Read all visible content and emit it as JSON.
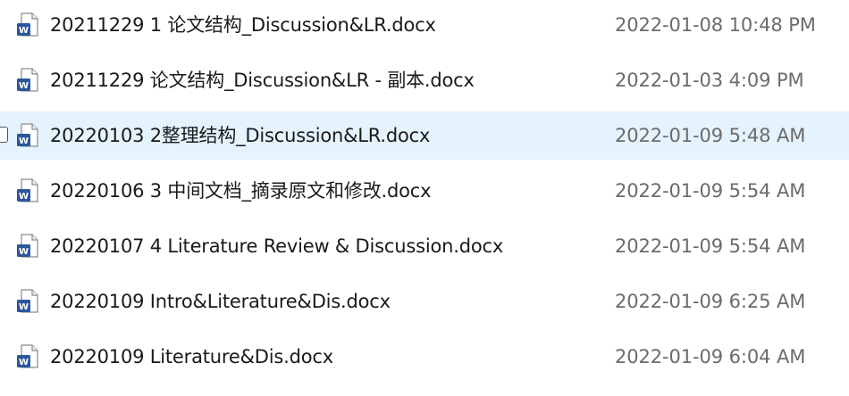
{
  "accent_color": "#2b579a",
  "selected_row_color": "#e5f3ff",
  "files": [
    {
      "name": "20211229 1 论文结构_Discussion&LR.docx",
      "modified": "2022-01-08 10:48 PM",
      "icon": "word-document-icon"
    },
    {
      "name": "20211229 论文结构_Discussion&LR - 副本.docx",
      "modified": "2022-01-03 4:09 PM",
      "icon": "word-document-icon"
    },
    {
      "name": "20220103 2整理结构_Discussion&LR.docx",
      "modified": "2022-01-09 5:48 AM",
      "icon": "word-document-icon",
      "selected": true
    },
    {
      "name": "20220106 3 中间文档_摘录原文和修改.docx",
      "modified": "2022-01-09 5:54 AM",
      "icon": "word-document-icon"
    },
    {
      "name": "20220107 4 Literature Review & Discussion.docx",
      "modified": "2022-01-09 5:54 AM",
      "icon": "word-document-icon"
    },
    {
      "name": "20220109 Intro&Literature&Dis.docx",
      "modified": "2022-01-09 6:25 AM",
      "icon": "word-document-icon"
    },
    {
      "name": "20220109 Literature&Dis.docx",
      "modified": "2022-01-09 6:04 AM",
      "icon": "word-document-icon"
    }
  ]
}
